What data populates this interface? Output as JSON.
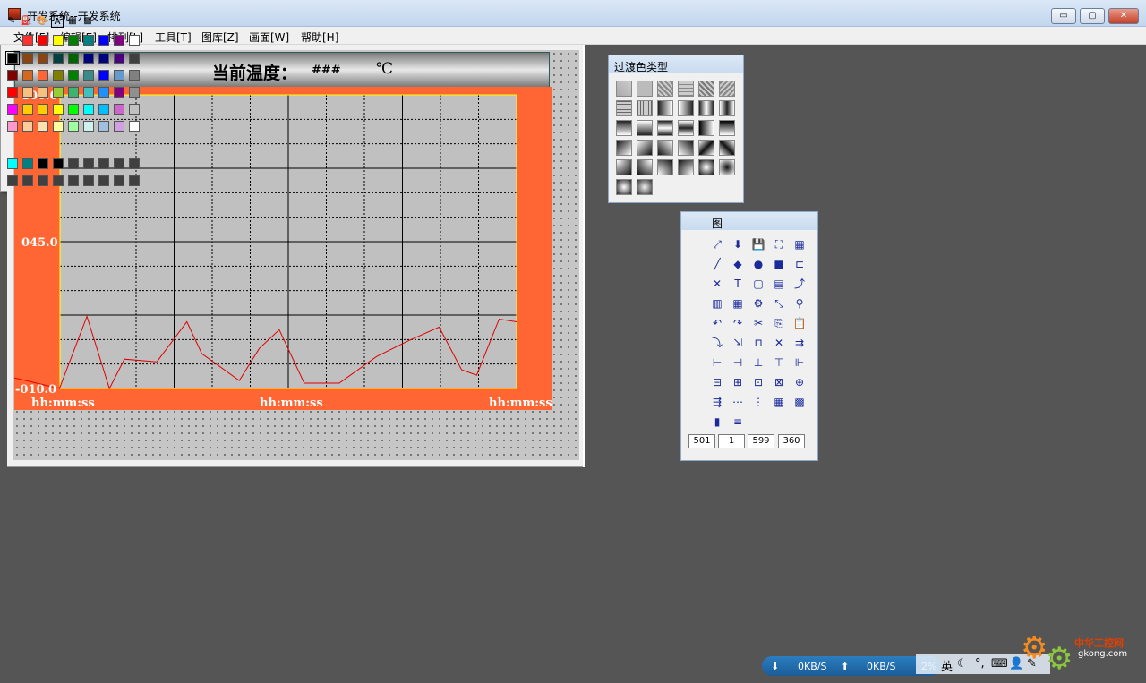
{
  "window": {
    "title": "开发系统--开发系统",
    "minimize": "▭",
    "maximize": "▢",
    "close": "✕"
  },
  "menu": [
    "文件[F]",
    "编辑[E]",
    "排列[L]",
    "工具[T]",
    "图库[Z]",
    "画面[W]",
    "帮助[H]"
  ],
  "temp_display": {
    "label": "当前温度：",
    "value": "###",
    "unit": "℃"
  },
  "chart_data": {
    "type": "line",
    "title": "",
    "xlabel": "",
    "ylabel": "",
    "ylim": [
      -10,
      100
    ],
    "y_tick_labels": [
      "100.0",
      "045.0",
      "-010.0"
    ],
    "x_tick_labels": [
      "hh:mm:ss",
      "hh:mm:ss",
      "hh:mm:ss"
    ],
    "grid": true,
    "series": [
      {
        "color": "#e00000",
        "x": [
          0,
          0.085,
          0.14,
          0.185,
          0.215,
          0.28,
          0.34,
          0.37,
          0.445,
          0.485,
          0.525,
          0.575,
          0.645,
          0.72,
          0.785,
          0.845,
          0.89,
          0.92,
          0.965,
          1.0
        ],
        "y": [
          -6,
          -10,
          17,
          -10,
          1,
          0,
          15,
          3,
          -7,
          5,
          12,
          -8,
          -8,
          2,
          8,
          13,
          -3,
          -5,
          16,
          15
        ]
      }
    ],
    "colors": {
      "background": "#ff6633",
      "plot": "#c0c0c0",
      "frame": "#ffff00"
    }
  },
  "gradient_panel": {
    "title": "过渡色类型"
  },
  "tool_panel": {
    "title": "图",
    "coords": [
      "501",
      "1",
      "599",
      "360"
    ]
  },
  "color_panel": {
    "mode_icons": [
      "pen-icon",
      "fill-icon",
      "palette-icon",
      "text-color-icon",
      "pattern-icon",
      "grid-color-icon"
    ],
    "rows": [
      [
        "#ff3030",
        "#ff0000",
        "#ffff00",
        "#008000",
        "#008080",
        "#0000ff",
        "#800080",
        "#ffffff"
      ],
      [
        "#000000",
        "#8b4513",
        "#8b4513",
        "#004040",
        "#006400",
        "#000080",
        "#000080",
        "#4b0082",
        "#404040"
      ],
      [
        "#800000",
        "#d2691e",
        "#ff6633",
        "#808000",
        "#008000",
        "#3a8a8a",
        "#0000ff",
        "#6699cc",
        "#808080"
      ],
      [
        "#ff0000",
        "#f5c080",
        "#f5c080",
        "#9acd32",
        "#3cb371",
        "#40c0c0",
        "#1e90ff",
        "#800080",
        "#909090"
      ],
      [
        "#ff00ff",
        "#ffcc00",
        "#ffcc00",
        "#ffff00",
        "#00ff00",
        "#00ffff",
        "#00bfff",
        "#cc66cc",
        "#c0c0c0"
      ],
      [
        "#ff99cc",
        "#ffcc99",
        "#ffe0b0",
        "#ffffa0",
        "#a0ffa0",
        "#d0f0f0",
        "#a0c0e0",
        "#d0a0e0",
        "#ffffff"
      ]
    ],
    "custom_row_1": [
      "#00ffff",
      "#008080",
      "#000000",
      "#000000",
      "#404040",
      "#404040",
      "#404040",
      "#404040",
      "#404040"
    ],
    "custom_row_2": [
      "#404040",
      "#404040",
      "#404040",
      "#404040",
      "#404040",
      "#404040",
      "#404040",
      "#404040",
      "#404040"
    ]
  },
  "netmon": {
    "down": "0KB/S",
    "up": "0KB/S",
    "cpu": "2%"
  },
  "tray": {
    "ime": "英"
  },
  "watermark": {
    "site_cn": "中华工控网",
    "site": "gkong.com"
  }
}
